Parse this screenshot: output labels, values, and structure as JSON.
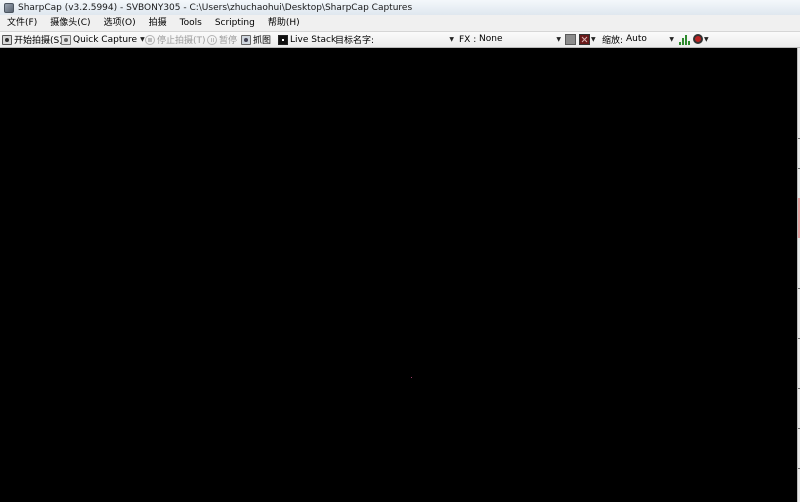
{
  "window": {
    "title": "SharpCap (v3.2.5994) - SVBONY305 - C:\\Users\\zhuchaohui\\Desktop\\SharpCap Captures"
  },
  "menu": [
    {
      "label": "文件(F)"
    },
    {
      "label": "摄像头(C)"
    },
    {
      "label": "选项(O)"
    },
    {
      "label": "拍摄"
    },
    {
      "label": "Tools"
    },
    {
      "label": "Scripting"
    },
    {
      "label": "帮助(H)"
    }
  ],
  "toolbar": {
    "start_capture": "开始拍摄(S)",
    "quick_capture": "Quick Capture",
    "stop_capture": "停止拍摄(T)",
    "pause": "暂停",
    "snapshot": "抓图",
    "live_stack": "Live Stack",
    "target_name_label": "目标名字:",
    "target_name_value": "",
    "fx_label": "FX :",
    "fx_value": "None",
    "zoom_label": "缩放:",
    "zoom_value": "Auto"
  },
  "icons": {
    "start_capture": "camera-record-icon",
    "quick_capture": "camera-icon",
    "stop_capture": "stop-icon",
    "pause": "pause-icon",
    "snapshot": "snapshot-icon",
    "live_stack": "live-stack-icon",
    "histogram": "histogram-icon",
    "magnifier": "magnifier-icon"
  },
  "colors": {
    "viewer_background": "#000000",
    "gray_swatch": "#8c8c8c",
    "red_swatch": "#6a1a1a"
  }
}
